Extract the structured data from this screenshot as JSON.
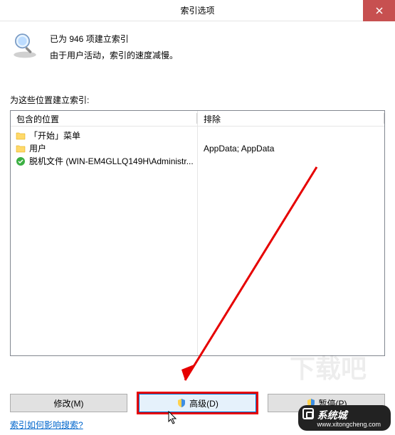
{
  "titlebar": {
    "title": "索引选项"
  },
  "status": {
    "line1": "已为 946 项建立索引",
    "line2": "由于用户活动，索引的速度减慢。"
  },
  "section_label": "为这些位置建立索引:",
  "columns": {
    "included_header": "包含的位置",
    "excluded_header": "排除"
  },
  "included_items": [
    {
      "icon": "folder",
      "label": "「开始」菜单"
    },
    {
      "icon": "folder",
      "label": "用户"
    },
    {
      "icon": "offline",
      "label": "脱机文件 (WIN-EM4GLLQ149H\\Administr..."
    }
  ],
  "excluded_items": [
    {
      "label": ""
    },
    {
      "label": "AppData; AppData"
    },
    {
      "label": ""
    }
  ],
  "buttons": {
    "modify": "修改(M)",
    "advanced": "高级(D)",
    "pause": "暂停(P)"
  },
  "help_link": "索引如何影响搜索?",
  "watermark": {
    "brand": "系统城",
    "url": "www.xitongcheng.com"
  }
}
